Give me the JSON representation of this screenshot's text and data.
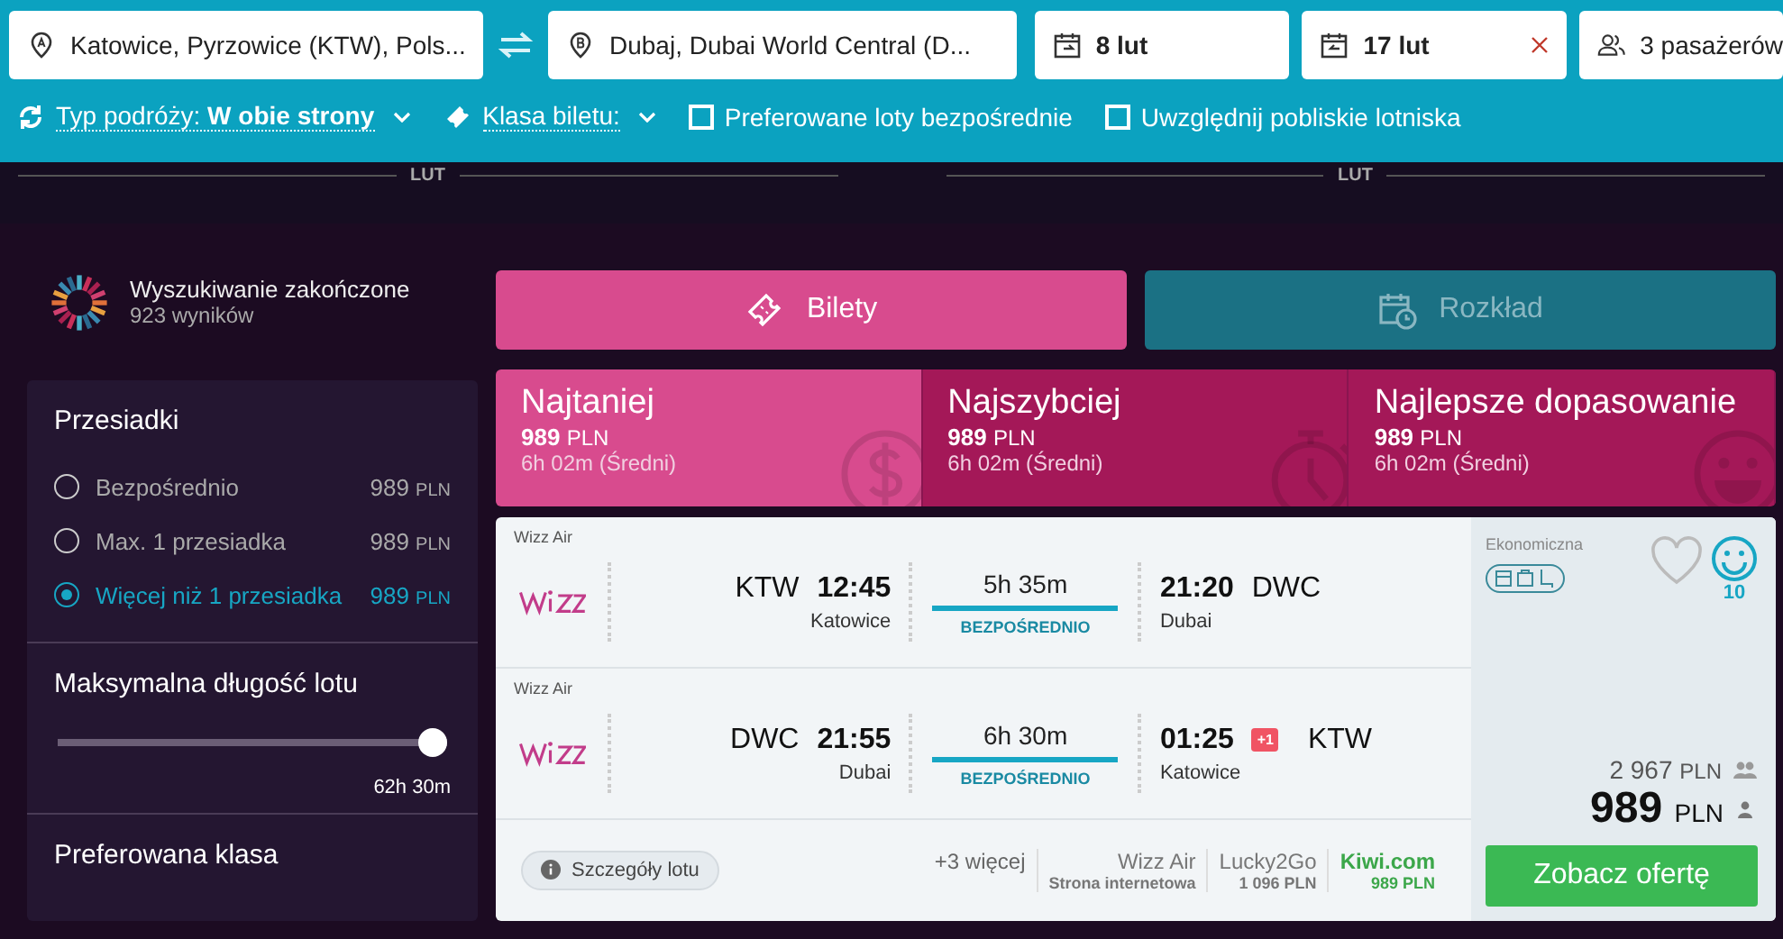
{
  "search": {
    "origin": "Katowice, Pyrzowice (KTW), Pols...",
    "destination": "Dubaj, Dubai World Central (D...",
    "depart": "8 lut",
    "return": "17 lut",
    "passengers": "3 pasażerów"
  },
  "options": {
    "trip_type_label": "Typ podróży:",
    "trip_type_value": "W obie strony",
    "ticket_class_label": "Klasa biletu:",
    "checkboxes": [
      {
        "label": "Preferowane loty bezpośrednie",
        "checked": false
      },
      {
        "label": "Uwzględnij pobliskie lotniska",
        "checked": false
      }
    ]
  },
  "timeline": [
    "LUT",
    "LUT"
  ],
  "status": {
    "title": "Wyszukiwanie zakończone",
    "count": "923 wyników"
  },
  "stops_filter": {
    "title": "Przesiadki",
    "options": [
      {
        "label": "Bezpośrednio",
        "price": "989",
        "currency": "PLN",
        "selected": false
      },
      {
        "label": "Max. 1 przesiadka",
        "price": "989",
        "currency": "PLN",
        "selected": false
      },
      {
        "label": "Więcej niż 1 przesiadka",
        "price": "989",
        "currency": "PLN",
        "selected": true
      }
    ]
  },
  "duration_filter": {
    "title": "Maksymalna długość lotu",
    "level": 1,
    "reading": "62h 30m"
  },
  "class_filter": {
    "title": "Preferowana klasa"
  },
  "view_tabs": [
    {
      "label": "Bilety",
      "kind": "tickets",
      "selected": true
    },
    {
      "label": "Rozkład",
      "kind": "schedule",
      "selected": false
    }
  ],
  "sort_tabs": [
    {
      "kind": "cheapest",
      "label": "Najtaniej",
      "price": "989",
      "currency": "PLN",
      "duration": "6h 02m (Średni)",
      "selected": true
    },
    {
      "kind": "fastest",
      "label": "Najszybciej",
      "price": "989",
      "currency": "PLN",
      "duration": "6h 02m (Średni)",
      "selected": false
    },
    {
      "kind": "best",
      "label": "Najlepsze dopasowanie",
      "price": "989",
      "currency": "PLN",
      "duration": "6h 02m (Średni)",
      "selected": false
    }
  ],
  "result": {
    "legs": [
      {
        "carrier": "Wizz Air",
        "from_code": "KTW",
        "from_time": "12:45",
        "from_city": "Katowice",
        "duration": "5h 35m",
        "stops": "BEZPOŚREDNIO",
        "to_time": "21:20",
        "to_code": "DWC",
        "to_city": "Dubai"
      },
      {
        "carrier": "Wizz Air",
        "from_code": "DWC",
        "from_time": "21:55",
        "from_city": "Dubai",
        "duration": "6h 30m",
        "stops": "BEZPOŚREDNIO",
        "to_time": "01:25",
        "day_offset": "+1",
        "to_code": "KTW",
        "to_city": "Katowice"
      }
    ],
    "details_button": "Szczegóły lotu",
    "more": "+3 więcej",
    "providers": [
      {
        "name": "Wizz Air",
        "sub": "Strona internetowa",
        "highlighted": false
      },
      {
        "name": "Lucky2Go",
        "sub": "1 096 PLN",
        "highlighted": false
      },
      {
        "name": "Kiwi.com",
        "sub": "989 PLN",
        "highlighted": true
      }
    ],
    "cabin": "Ekonomiczna",
    "favorite": false,
    "score": "10",
    "total": "2 967",
    "total_currency": "PLN",
    "price": "989",
    "currency": "PLN",
    "offer_button": "Zobacz ofertę"
  }
}
